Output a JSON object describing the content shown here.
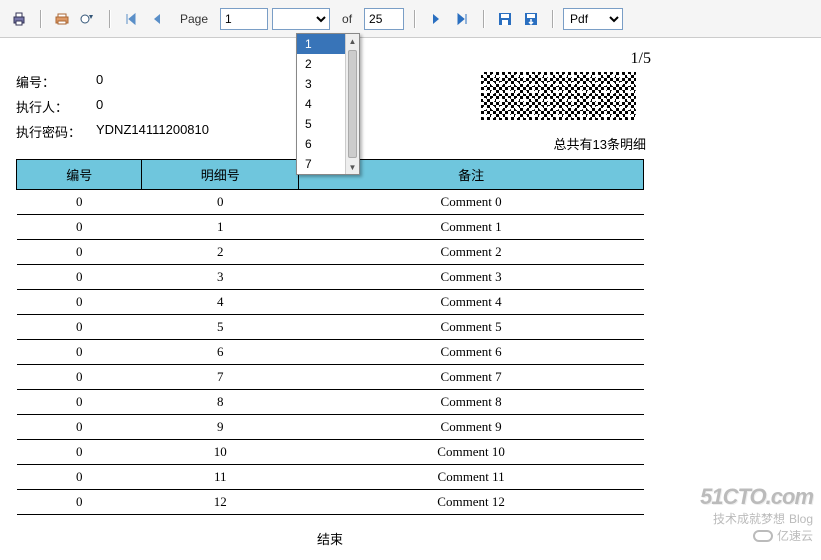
{
  "toolbar": {
    "page_label": "Page",
    "page_value": "1",
    "of_label": "of",
    "total_pages": "25",
    "format": "Pdf",
    "dropdown_items": [
      "1",
      "2",
      "3",
      "4",
      "5",
      "6",
      "7"
    ],
    "dropdown_selected": "1"
  },
  "report": {
    "page_indicator": "1/5",
    "fields": {
      "id_label": "编号：",
      "id_value": "0",
      "exec_label": "执行人：",
      "exec_value": "0",
      "pwd_label": "执行密码：",
      "pwd_value": "YDNZ14111200810"
    },
    "totals_text": "总共有13条明细",
    "columns": {
      "id": "编号",
      "detail": "明细号",
      "comment": "备注"
    },
    "rows": [
      {
        "id": "0",
        "det": "0",
        "cmt": "Comment 0"
      },
      {
        "id": "0",
        "det": "1",
        "cmt": "Comment 1"
      },
      {
        "id": "0",
        "det": "2",
        "cmt": "Comment 2"
      },
      {
        "id": "0",
        "det": "3",
        "cmt": "Comment 3"
      },
      {
        "id": "0",
        "det": "4",
        "cmt": "Comment 4"
      },
      {
        "id": "0",
        "det": "5",
        "cmt": "Comment 5"
      },
      {
        "id": "0",
        "det": "6",
        "cmt": "Comment 6"
      },
      {
        "id": "0",
        "det": "7",
        "cmt": "Comment 7"
      },
      {
        "id": "0",
        "det": "8",
        "cmt": "Comment 8"
      },
      {
        "id": "0",
        "det": "9",
        "cmt": "Comment 9"
      },
      {
        "id": "0",
        "det": "10",
        "cmt": "Comment 10"
      },
      {
        "id": "0",
        "det": "11",
        "cmt": "Comment 11"
      },
      {
        "id": "0",
        "det": "12",
        "cmt": "Comment 12"
      }
    ],
    "footer": "结束"
  },
  "watermark": {
    "logo": "51CTO.com",
    "tagline": "技术成就梦想",
    "blog": "Blog",
    "brand": "亿速云"
  }
}
